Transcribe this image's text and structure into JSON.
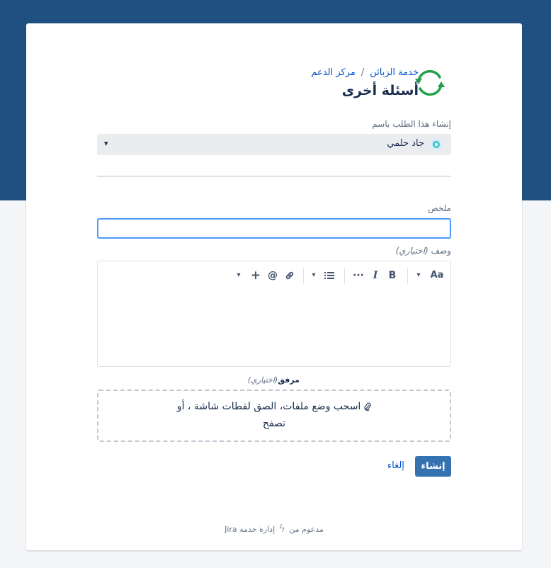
{
  "breadcrumb": {
    "service_desk": "خدمة الزبائن",
    "separator": "/",
    "help_center": "مركز الدعم"
  },
  "page_title": "أسئلة أخرى",
  "raise_on_behalf": {
    "label": "إنشاء هذا الطلب باسم",
    "selected_user": "جاد حلمي"
  },
  "summary": {
    "label": "ملخص",
    "value": ""
  },
  "description": {
    "label": "وصف",
    "optional": "(اختياري)",
    "toolbar": {
      "text_style": "Aa",
      "bold": "B",
      "italic": "I",
      "more": "···",
      "mention": "@",
      "insert": "+"
    }
  },
  "attachment": {
    "label": "مرفق",
    "optional": "(اختياري)",
    "drop_text": "اسحب وضع ملفات، الصق لقطات شاشة ، أو",
    "browse": "تصفح"
  },
  "actions": {
    "create": "إنشاء",
    "cancel": "إلغاء"
  },
  "footer": {
    "powered_by": "مدعوم من",
    "product": "إدارة خدمة Jira"
  },
  "colors": {
    "header_band": "#205081",
    "primary_button": "#3572b0",
    "link": "#0052cc",
    "focus_border": "#4c9aff",
    "logo_green": "#21a04a"
  },
  "icons": [
    "refresh-logo-icon",
    "avatar-icon",
    "chevron-down-icon",
    "bold-icon",
    "italic-icon",
    "more-icon",
    "bullet-list-icon",
    "link-icon",
    "mention-icon",
    "plus-icon",
    "paperclip-icon",
    "bolt-icon"
  ]
}
